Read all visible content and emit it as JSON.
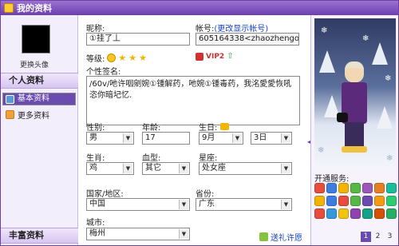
{
  "window": {
    "title": "我的资料"
  },
  "left": {
    "change_avatar": "更换头像",
    "section_personal": "个人资料",
    "items": [
      {
        "label": "基本资料",
        "icon": "card-icon",
        "color": "#6a4bb0"
      },
      {
        "label": "更多资料",
        "icon": "profile-icon",
        "color": "#ffffff"
      }
    ],
    "section_bottom": "丰富资料"
  },
  "form": {
    "nickname_label": "昵称:",
    "nickname_value": "①挂了丄",
    "account_label": "帐号:",
    "account_link": "(更改显示帐号)",
    "account_value": "605164338<zhaozhengong@qq",
    "level_label": "等级:",
    "vip_label": "VIP2",
    "signature_label": "个性签名:",
    "signature_value": "/60v/吔许咽剜婉①锺解药，吔婉①锺毒药，我洺愛愛恢吼恣你暗圮忆.",
    "gender_label": "性别:",
    "gender_value": "男",
    "age_label": "年龄:",
    "age_value": "17",
    "birthday_label": "生日:",
    "birth_month": "9月",
    "birth_day": "3日",
    "zodiac_label": "生肖:",
    "zodiac_value": "鸡",
    "blood_label": "血型:",
    "blood_value": "其它",
    "sign_label": "星座:",
    "sign_value": "处女座",
    "country_label": "国家/地区:",
    "country_value": "中国",
    "province_label": "省份:",
    "province_value": "广东",
    "city_label": "城市:",
    "city_value": "梅州",
    "gift_link": "送礼许愿"
  },
  "right": {
    "services_label": "开通服务:",
    "service_colors": [
      "#e94b3c",
      "#3b7de0",
      "#f3b400",
      "#56b847",
      "#9b59b6",
      "#e67e22",
      "#1abc9c",
      "#f3b400",
      "#3b7de0",
      "#e94b3c",
      "#56b847",
      "#6a4bb0",
      "#f39c12",
      "#2ecc71",
      "#e74c3c",
      "#3498db",
      "#f1c40f",
      "#8e44ad",
      "#16a085",
      "#d35400",
      "#27ae60"
    ],
    "pages": [
      "1",
      "2",
      "3"
    ],
    "current_page": "1"
  }
}
